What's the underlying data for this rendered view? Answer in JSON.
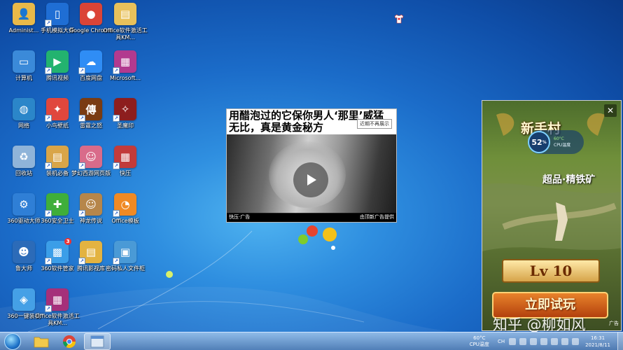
{
  "desktop": {
    "icons": [
      {
        "label": "Administ...",
        "icon": "user-folder-icon",
        "color": "#e9b949"
      },
      {
        "label": "手机模拟大师",
        "icon": "phone-emulator-icon",
        "color": "#1f6ed4"
      },
      {
        "label": "Google Chrome",
        "icon": "chrome-icon",
        "color": "#db4437"
      },
      {
        "label": "Office软件激活工具KM...",
        "icon": "folder-icon",
        "color": "#e8c15b"
      },
      {
        "label": "计算机",
        "icon": "computer-icon",
        "color": "#3b8ad9"
      },
      {
        "label": "腾讯视频",
        "icon": "tencent-video-icon",
        "color": "#23b36f"
      },
      {
        "label": "百度网盘",
        "icon": "baidu-netdisk-icon",
        "color": "#2f8df5"
      },
      {
        "label": "Microsoft...",
        "icon": "winrar-icon",
        "color": "#b23a8f"
      },
      {
        "label": "网络",
        "icon": "network-icon",
        "color": "#2b86c9"
      },
      {
        "label": "小鸟壁纸",
        "icon": "bird-wallpaper-icon",
        "color": "#e0473d"
      },
      {
        "label": "雷霆之怒",
        "icon": "game-leiting-icon",
        "color": "#7a3b12"
      },
      {
        "label": "圣魔印",
        "icon": "game-shengmo-icon",
        "color": "#8d1e1e"
      },
      {
        "label": "回收站",
        "icon": "recycle-bin-icon",
        "color": "#8fb4d9"
      },
      {
        "label": "装机必备",
        "icon": "install-folder-icon",
        "color": "#d9a548"
      },
      {
        "label": "梦幻西游网页版",
        "icon": "game-menghuan-icon",
        "color": "#d96b8a"
      },
      {
        "label": "快压",
        "icon": "kuaiya-icon",
        "color": "#c23b3b"
      },
      {
        "label": "360驱动大师",
        "icon": "driver-master-icon",
        "color": "#2f7fd6"
      },
      {
        "label": "360安全卫士",
        "icon": "360-safe-icon",
        "color": "#3fae3a"
      },
      {
        "label": "神龙传说",
        "icon": "game-shenlong-icon",
        "color": "#b6864a"
      },
      {
        "label": "Office模板",
        "icon": "office-template-icon",
        "color": "#f08a24"
      },
      {
        "label": "鲁大师",
        "icon": "ludashi-icon",
        "color": "#2c6bb8"
      },
      {
        "label": "360软件管家",
        "icon": "software-manager-icon",
        "color": "#3b9ee8",
        "badge": "3"
      },
      {
        "label": "腾讯影视库",
        "icon": "video-folder-icon",
        "color": "#e3b341"
      },
      {
        "label": "密码私人文件柜",
        "icon": "private-cabinet-icon",
        "color": "#4a9ad6"
      },
      {
        "label": "360一键装机",
        "icon": "one-click-install-icon",
        "color": "#45a0e6"
      },
      {
        "label": "Office软件激活工具KM...",
        "icon": "winrar-archive-icon",
        "color": "#a5307a"
      }
    ]
  },
  "ad_popup": {
    "headline": "用醋泡过的它保你男人‘那里’威猛无比，真是黄金秘方",
    "dismiss_label": "近期不再展示",
    "source_left": "快压·广告",
    "source_right": "由顶新广告提供"
  },
  "game_ad": {
    "title": "新手村",
    "subtitle": "超品·精铁矿",
    "level": "Lv 10",
    "cta": "立即试玩",
    "ad_tag": "广告",
    "close_label": "✕"
  },
  "cpu_widget": {
    "usage_percent": "52",
    "usage_unit": "%",
    "temperature": "60°C",
    "label": "CPU温度"
  },
  "watermark": "知乎 @柳如风",
  "taskbar": {
    "tray_temperature": "60°C",
    "tray_temperature_label": "CPU温度",
    "ime": "CH",
    "time": "16:31",
    "date": "2021/8/11"
  }
}
